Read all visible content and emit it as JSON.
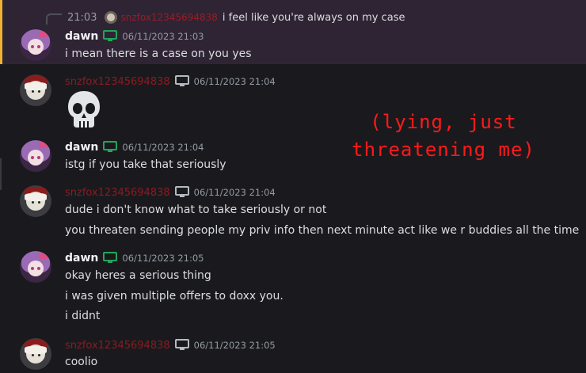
{
  "reply": {
    "time": "21:03",
    "author": "snzfox12345694838",
    "text": "i feel like you're always on my case"
  },
  "messages": [
    {
      "author": "dawn",
      "timestamp": "06/11/2023 21:03",
      "lines": [
        "i mean there is a case on you yes"
      ]
    },
    {
      "author": "snzfox12345694838",
      "timestamp": "06/11/2023 21:04",
      "emoji": "skull"
    },
    {
      "author": "dawn",
      "timestamp": "06/11/2023 21:04",
      "lines": [
        "istg if you take that seriously"
      ]
    },
    {
      "author": "snzfox12345694838",
      "timestamp": "06/11/2023 21:04",
      "lines": [
        "dude i don't know what to take seriously or not",
        "you threaten sending people my priv info then next minute act like we r buddies all the time"
      ]
    },
    {
      "author": "dawn",
      "timestamp": "06/11/2023 21:05",
      "lines": [
        "okay heres a serious thing",
        "i was given multiple offers to doxx you.",
        "i didnt"
      ]
    },
    {
      "author": "snzfox12345694838",
      "timestamp": "06/11/2023 21:05",
      "lines": [
        "coolio"
      ]
    }
  ],
  "annotation": {
    "lines": [
      "(lying, just",
      "threatening me)"
    ]
  },
  "icons": {
    "dawn_device": "desktop-icon-green",
    "fox_device": "desktop-icon-gray",
    "emoji": "skull-emoji"
  },
  "colors": {
    "dawn_device": "#23a55a",
    "fox_device": "#b5bac1",
    "fox_name": "#8b1a20",
    "mention_highlight": "#2f2434",
    "mention_bar": "#f0b232",
    "annotation": "#ff1a1a"
  }
}
